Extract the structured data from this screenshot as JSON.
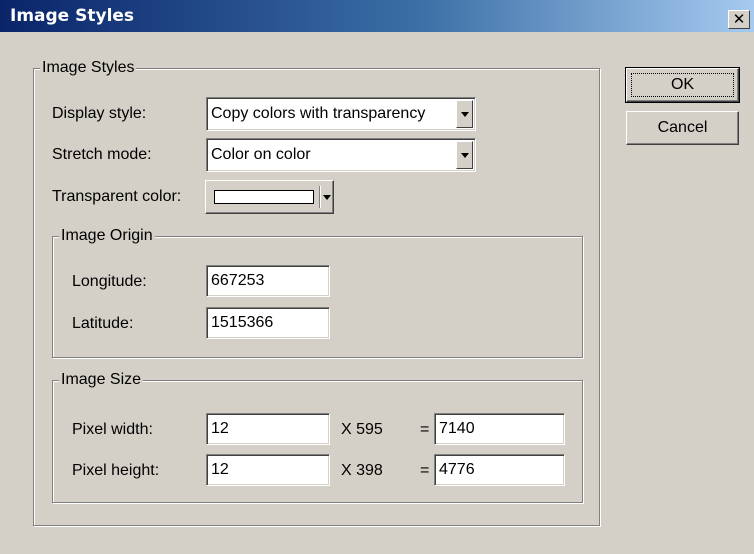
{
  "window": {
    "title": "Image Styles",
    "close_glyph": "✕"
  },
  "group_main": {
    "label": "Image Styles"
  },
  "display_style": {
    "label": "Display style:",
    "value": "Copy colors with transparency"
  },
  "stretch_mode": {
    "label": "Stretch mode:",
    "value": "Color on color"
  },
  "transparent_color": {
    "label": "Transparent color:",
    "swatch_color": "#ffffff"
  },
  "image_origin": {
    "label": "Image Origin",
    "longitude_label": "Longitude:",
    "longitude_value": "667253",
    "latitude_label": "Latitude:",
    "latitude_value": "1515366"
  },
  "image_size": {
    "label": "Image Size",
    "width_label": "Pixel width:",
    "width_value": "12",
    "width_multiplier": "X 595",
    "width_equals": "=",
    "width_result": "7140",
    "height_label": "Pixel height:",
    "height_value": "12",
    "height_multiplier": "X 398",
    "height_equals": "=",
    "height_result": "4776"
  },
  "buttons": {
    "ok": "OK",
    "cancel": "Cancel"
  }
}
